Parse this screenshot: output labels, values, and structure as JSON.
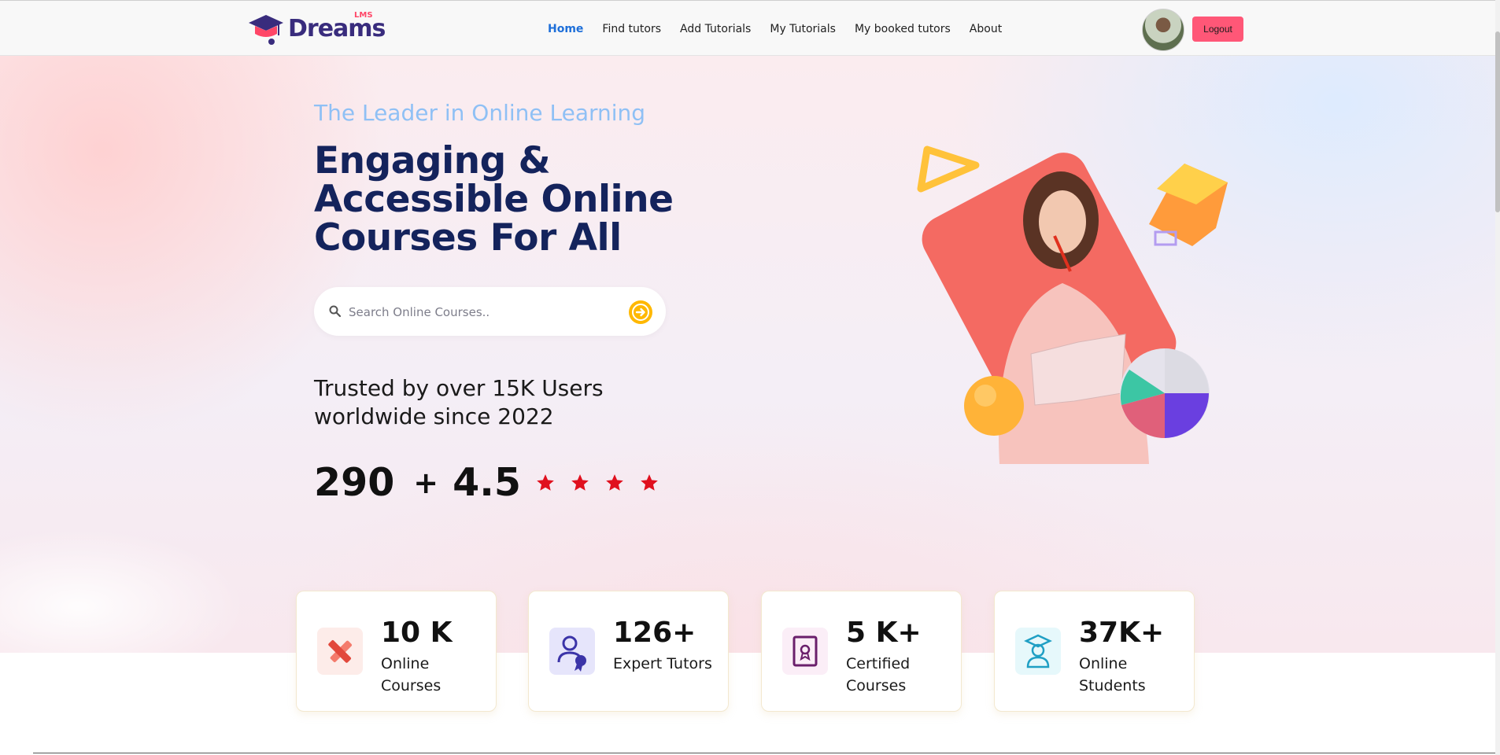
{
  "brand": {
    "name": "Dreams",
    "superscript": "LMS"
  },
  "nav": {
    "items": [
      {
        "label": "Home",
        "active": true
      },
      {
        "label": "Find tutors",
        "active": false
      },
      {
        "label": "Add Tutorials",
        "active": false
      },
      {
        "label": "My Tutorials",
        "active": false
      },
      {
        "label": "My booked tutors",
        "active": false
      },
      {
        "label": "About",
        "active": false
      }
    ],
    "logout_label": "Logout"
  },
  "hero": {
    "subtitle": "The Leader in Online Learning",
    "headline": "Engaging & Accessible Online Courses For All",
    "search": {
      "placeholder": "Search Online Courses.."
    },
    "trusted": "Trusted by over 15K Users worldwide since 2022",
    "count": "290",
    "plus": "+",
    "rating": "4.5",
    "stars": 4
  },
  "stats": [
    {
      "value": "10 K",
      "label": "Online Courses",
      "icon": "pencil-ruler-icon"
    },
    {
      "value": "126+",
      "label": "Expert Tutors",
      "icon": "expert-tutor-icon"
    },
    {
      "value": "5 K+",
      "label": "Certified Courses",
      "icon": "certificate-icon"
    },
    {
      "value": "37K+",
      "label": "Online Students",
      "icon": "graduate-student-icon"
    }
  ],
  "colors": {
    "brand": "#392c7d",
    "accent_pink": "#ff5777",
    "active_link": "#1e6fd9",
    "headline": "#14235c",
    "subtitle": "#8fc0f5",
    "star": "#e0101e",
    "search_button": "#ffb800"
  }
}
